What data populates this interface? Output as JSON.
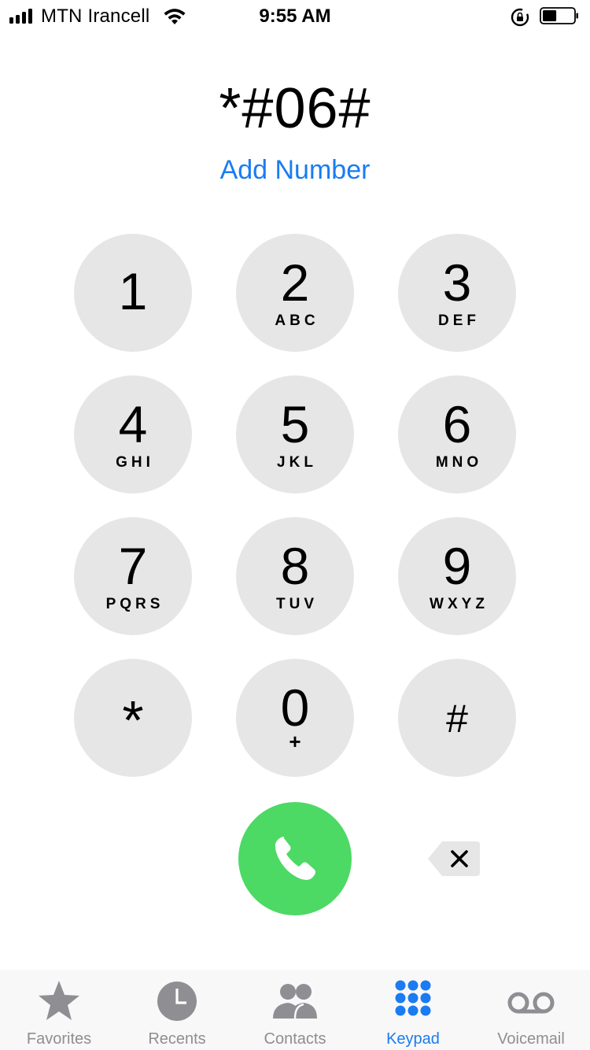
{
  "status_bar": {
    "carrier": "MTN Irancell",
    "time": "9:55 AM",
    "icons": [
      "signal-icon",
      "wifi-icon",
      "rotation-lock-icon",
      "battery-icon"
    ],
    "battery_level": 0.45
  },
  "dialer": {
    "number": "*#06#",
    "add_number": "Add Number"
  },
  "keypad": {
    "keys": [
      {
        "digit": "1",
        "letters": ""
      },
      {
        "digit": "2",
        "letters": "ABC"
      },
      {
        "digit": "3",
        "letters": "DEF"
      },
      {
        "digit": "4",
        "letters": "GHI"
      },
      {
        "digit": "5",
        "letters": "JKL"
      },
      {
        "digit": "6",
        "letters": "MNO"
      },
      {
        "digit": "7",
        "letters": "PQRS"
      },
      {
        "digit": "8",
        "letters": "TUV"
      },
      {
        "digit": "9",
        "letters": "WXYZ"
      },
      {
        "digit": "*",
        "letters": ""
      },
      {
        "digit": "0",
        "letters": "+"
      },
      {
        "digit": "#",
        "letters": ""
      }
    ]
  },
  "actions": {
    "call_icon": "phone-icon",
    "delete_icon": "backspace-icon"
  },
  "tabs": [
    {
      "label": "Favorites",
      "icon": "star-icon",
      "active": false
    },
    {
      "label": "Recents",
      "icon": "clock-icon",
      "active": false
    },
    {
      "label": "Contacts",
      "icon": "contacts-icon",
      "active": false
    },
    {
      "label": "Keypad",
      "icon": "keypad-icon",
      "active": true
    },
    {
      "label": "Voicemail",
      "icon": "voicemail-icon",
      "active": false
    }
  ],
  "colors": {
    "accent": "#1a7cf0",
    "call_green": "#4cd964",
    "key_gray": "#e6e6e6",
    "inactive_tab": "#8e8e93"
  }
}
